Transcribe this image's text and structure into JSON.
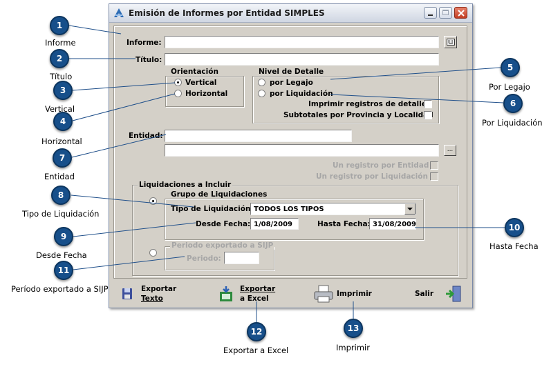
{
  "window": {
    "title": "Emisión de Informes por Entidad SIMPLES"
  },
  "form": {
    "informe_label": "Informe:",
    "titulo_label": "Título:",
    "orientacion": {
      "title": "Orientación",
      "vertical": "Vertical",
      "horizontal": "Horizontal"
    },
    "nivel": {
      "title": "Nivel de Detalle",
      "por_legajo": "por Legajo",
      "por_liquidacion": "por Liquidación",
      "imprimir_registros": "Imprimir registros de detalle",
      "subtotales": "Subtotales por Provincia y Localidad"
    },
    "entidad_label": "Entidad:",
    "browse_button": "...",
    "un_registro_entidad": "Un registro por Entidad",
    "un_registro_liquidacion": "Un registro por Liquidación",
    "liquidaciones": {
      "title": "Liquidaciones a Incluir",
      "grupo_title": "Grupo de Liquidaciones",
      "tipo_label": "Tipo de Liquidación:",
      "tipo_value": "TODOS LOS TIPOS",
      "desde_label": "Desde Fecha:",
      "desde_value": "1/08/2009",
      "hasta_label": "Hasta Fecha:",
      "hasta_value": "31/08/2009",
      "periodo_group_title": "Periodo exportado a SIJP",
      "periodo_label": "Periodo:"
    }
  },
  "footer": {
    "exportar_texto_line1": "Exportar",
    "exportar_texto_line2": "Texto",
    "exportar_excel_line1": "Exportar",
    "exportar_excel_line2": "a Excel",
    "imprimir": "Imprimir",
    "salir": "Salir"
  },
  "callouts": [
    {
      "num": "1",
      "caption": "Informe"
    },
    {
      "num": "2",
      "caption": "Título"
    },
    {
      "num": "3",
      "caption": "Vertical"
    },
    {
      "num": "4",
      "caption": "Horizontal"
    },
    {
      "num": "5",
      "caption": "Por Legajo"
    },
    {
      "num": "6",
      "caption": "Por Liquidación"
    },
    {
      "num": "7",
      "caption": "Entidad"
    },
    {
      "num": "8",
      "caption": "Tipo de Liquidación"
    },
    {
      "num": "9",
      "caption": "Desde Fecha"
    },
    {
      "num": "10",
      "caption": "Hasta Fecha"
    },
    {
      "num": "11",
      "caption": "Período exportado a SIJP"
    },
    {
      "num": "12",
      "caption": "Exportar a Excel"
    },
    {
      "num": "13",
      "caption": "Imprimir"
    }
  ],
  "colors": {
    "badge": "#174f8a",
    "window_bg": "#d4d0c8",
    "leader_line": "#1f4f8a"
  }
}
